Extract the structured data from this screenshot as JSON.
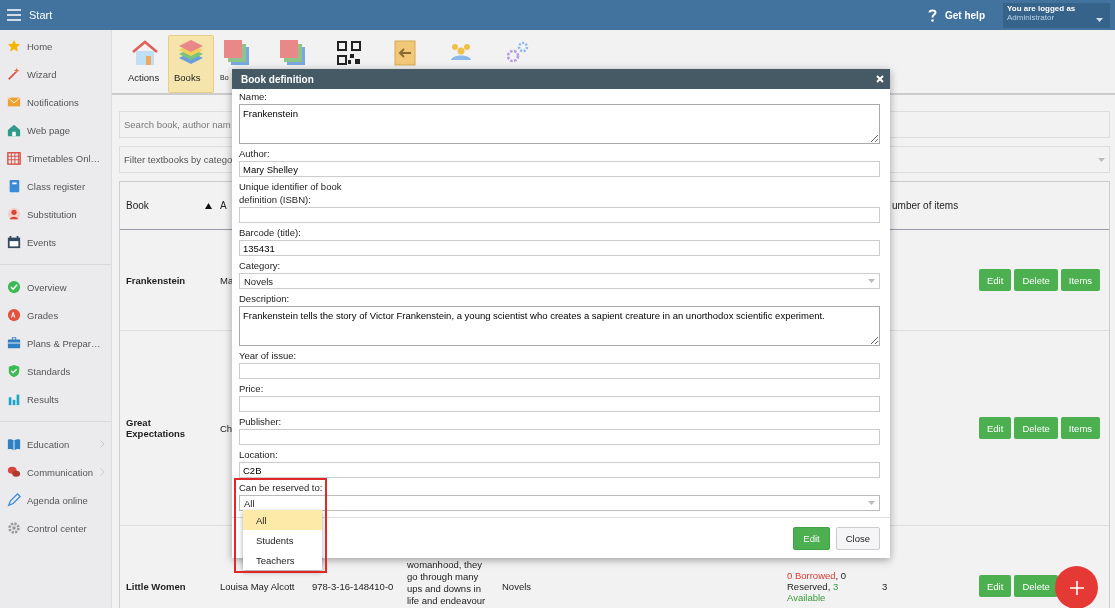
{
  "topbar": {
    "title": "Start",
    "help": "Get help",
    "user_caption": "You are logged as",
    "user_name": "Administrator"
  },
  "sidebar": {
    "groups": [
      {
        "items": [
          {
            "label": "Home",
            "submenu": false
          },
          {
            "label": "Wizard",
            "submenu": false
          },
          {
            "label": "Notifications",
            "submenu": false
          },
          {
            "label": "Web page",
            "submenu": false
          },
          {
            "label": "Timetables Onl…",
            "submenu": false
          },
          {
            "label": "Class register",
            "submenu": false
          },
          {
            "label": "Substitution",
            "submenu": false
          },
          {
            "label": "Events",
            "submenu": false
          }
        ]
      },
      {
        "items": [
          {
            "label": "Overview",
            "submenu": false
          },
          {
            "label": "Grades",
            "submenu": false
          },
          {
            "label": "Plans & Prepar…",
            "submenu": false
          },
          {
            "label": "Standards",
            "submenu": false
          },
          {
            "label": "Results",
            "submenu": false
          }
        ]
      },
      {
        "items": [
          {
            "label": "Education",
            "submenu": true
          },
          {
            "label": "Communication",
            "submenu": true
          },
          {
            "label": "Agenda online",
            "submenu": false
          },
          {
            "label": "Control center",
            "submenu": false
          }
        ]
      }
    ]
  },
  "toolbar": [
    {
      "label": "Actions",
      "selected": false
    },
    {
      "label": "Books",
      "selected": true
    },
    {
      "label": "Bo",
      "selected": false
    },
    {
      "selected": false
    },
    {
      "selected": false
    },
    {
      "selected": false
    },
    {
      "selected": false
    },
    {
      "selected": false
    }
  ],
  "search": {
    "placeholder": "Search book, author nam"
  },
  "filter": {
    "placeholder": "Filter textbooks by catego"
  },
  "table": {
    "columns": [
      {
        "label": "Book",
        "sorted": true
      },
      {
        "label": "A"
      },
      {
        "label": "umber of items"
      }
    ],
    "rows": [
      {
        "book": "Frankenstein",
        "author": "Ma",
        "buttons": [
          "Edit",
          "Delete",
          "Items"
        ]
      },
      {
        "book": "Great Expectations",
        "author": "Ch",
        "buttons": [
          "Edit",
          "Delete",
          "Items"
        ]
      },
      {
        "book": "Little Women",
        "author": "Louisa May Alcott",
        "isbn": "978-3-16-148410-0",
        "description": "womanhood, they go through many ups and downs in life and endeavour",
        "category": "Novels",
        "status": [
          {
            "text": "0 Borrowed",
            "kind": "alert"
          },
          {
            "text": ", 0 Reserved, ",
            "kind": "plain"
          },
          {
            "text": "3 Available",
            "kind": "ok"
          }
        ],
        "count": "3",
        "buttons": [
          "Edit",
          "Delete"
        ]
      }
    ]
  },
  "modal": {
    "title": "Book definition",
    "fields": [
      {
        "kind": "textarea",
        "label": "Name:",
        "value": "Frankenstein"
      },
      {
        "kind": "input",
        "label": "Author:",
        "value": "Mary Shelley"
      },
      {
        "kind": "input",
        "label": "Unique identifier of book definition (ISBN):"
      },
      {
        "kind": "input",
        "label": "Barcode (title):",
        "value": "135431"
      },
      {
        "kind": "select",
        "label": "Category:",
        "value": "Novels",
        "expanded": false
      },
      {
        "kind": "textarea",
        "label": "Description:",
        "value": "Frankenstein tells the story of Victor Frankenstein, a young scientist who creates a sapient creature in an unorthodox scientific experiment."
      },
      {
        "kind": "input",
        "label": "Year of issue:"
      },
      {
        "kind": "input",
        "label": "Price:"
      },
      {
        "kind": "input",
        "label": "Publisher:"
      },
      {
        "kind": "input",
        "label": "Location:",
        "value": "C2B"
      },
      {
        "kind": "select",
        "label": "Can be reserved to:",
        "value": "All",
        "expanded": true,
        "options": [
          {
            "label": "All",
            "selected": true
          },
          {
            "label": "Students",
            "selected": false
          },
          {
            "label": "Teachers",
            "selected": false
          }
        ]
      }
    ],
    "buttons": [
      {
        "label": "Edit",
        "kind": "primary"
      },
      {
        "label": "Close",
        "kind": "default"
      }
    ]
  }
}
